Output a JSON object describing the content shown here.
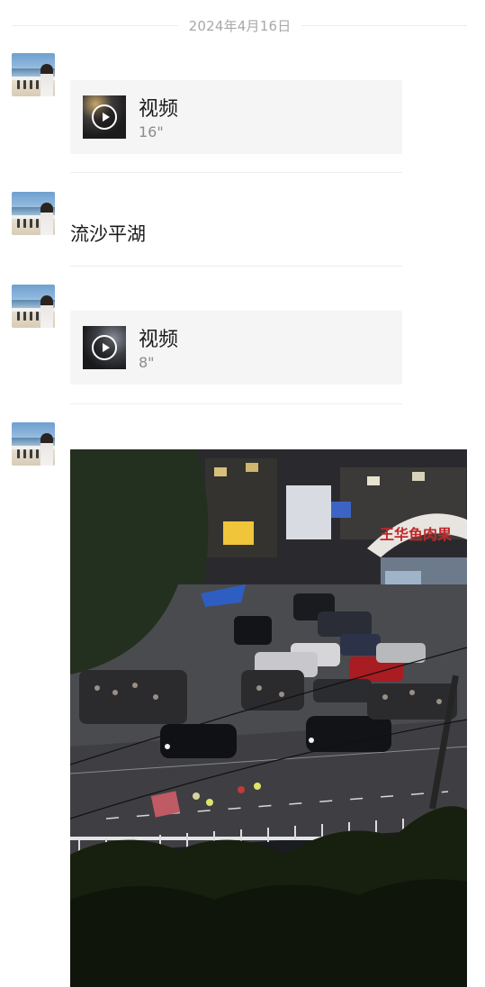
{
  "date_separator": "2024年4月16日",
  "messages": [
    {
      "type": "video",
      "title": "视频",
      "duration": "16\""
    },
    {
      "type": "text",
      "text": "流沙平湖"
    },
    {
      "type": "video",
      "title": "视频",
      "duration": "8\""
    },
    {
      "type": "image",
      "signs": {
        "shop_arch": "王华鱼肉果",
        "shop_sign": "",
        "store_sign": ""
      }
    }
  ],
  "colors": {
    "card_bg": "#f5f5f5",
    "date_text": "#a8a8a8",
    "divider": "#ededed"
  }
}
